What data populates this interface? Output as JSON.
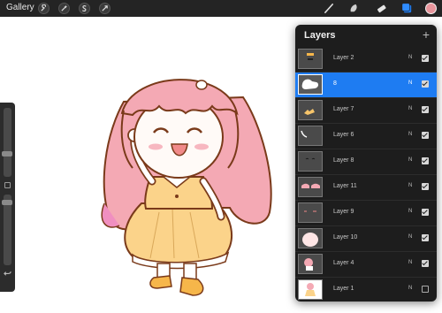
{
  "toolbar": {
    "gallery_label": "Gallery",
    "left_tools": [
      "wrench-icon",
      "magic-wand-icon",
      "selection-s-icon",
      "transform-arrow-icon"
    ],
    "right_tools": [
      "brush-icon",
      "smudge-icon",
      "eraser-icon",
      "layers-icon",
      "color-swatch"
    ],
    "color": "#e8959c"
  },
  "panel": {
    "title": "Layers",
    "add_label": "+",
    "layers": [
      {
        "name": "Layer 2",
        "mode": "N",
        "visible": true,
        "selected": false
      },
      {
        "name": "8",
        "mode": "N",
        "visible": true,
        "selected": true
      },
      {
        "name": "Layer 7",
        "mode": "N",
        "visible": true,
        "selected": false
      },
      {
        "name": "Layer 6",
        "mode": "N",
        "visible": true,
        "selected": false
      },
      {
        "name": "Layer 8",
        "mode": "N",
        "visible": true,
        "selected": false
      },
      {
        "name": "Layer 11",
        "mode": "N",
        "visible": true,
        "selected": false
      },
      {
        "name": "Layer 9",
        "mode": "N",
        "visible": true,
        "selected": false
      },
      {
        "name": "Layer 10",
        "mode": "N",
        "visible": true,
        "selected": false
      },
      {
        "name": "Layer 4",
        "mode": "N",
        "visible": true,
        "selected": false
      },
      {
        "name": "Layer 1",
        "mode": "N",
        "visible": false,
        "selected": false
      }
    ]
  },
  "colors": {
    "accent": "#1e7cf2",
    "hair": "#f4a9b4",
    "dress": "#fbd38a",
    "outline": "#7a3a1a"
  }
}
